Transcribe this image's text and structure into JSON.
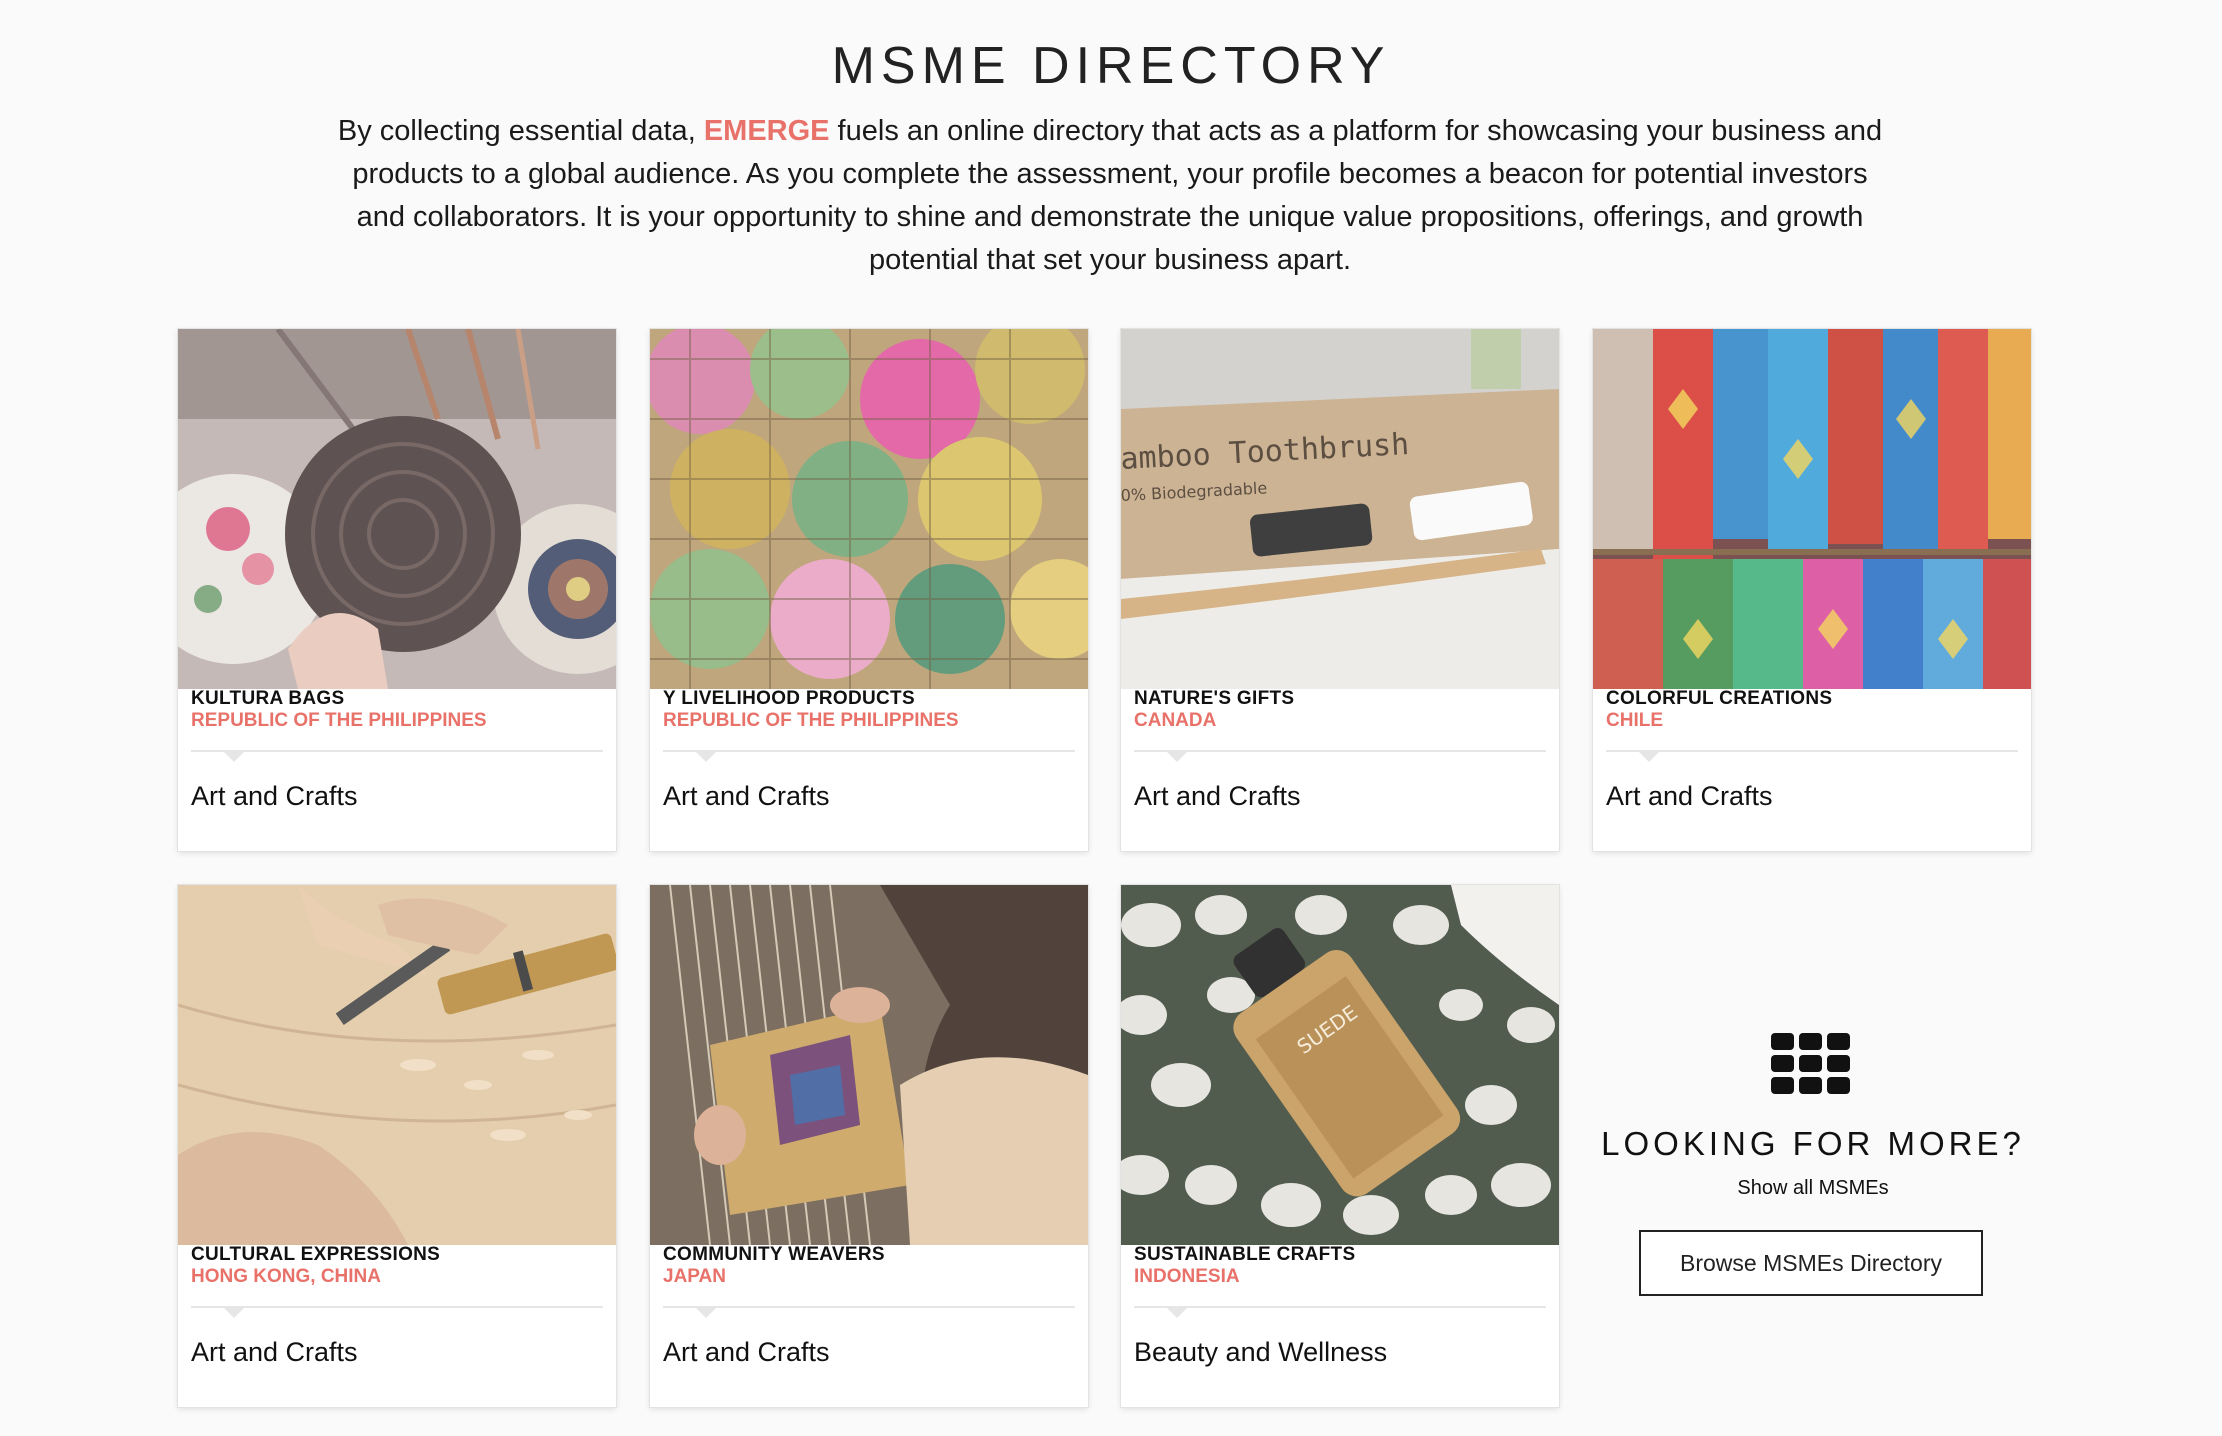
{
  "header": {
    "title": "MSME DIRECTORY",
    "intro_before": "By collecting essential data, ",
    "intro_brand": "EMERGE",
    "intro_after": " fuels an online directory that acts as a platform for showcasing your business and products to a global audience. As you complete the assessment, your profile becomes a beacon for potential investors and collaborators. It is your opportunity to shine and demonstrate the unique value propositions, offerings, and growth potential that set your business apart."
  },
  "colors": {
    "accent": "#e8726a",
    "text": "#111111",
    "background": "#fafafa"
  },
  "cards": [
    {
      "name": "KULTURA BAGS",
      "country": "REPUBLIC OF THE PHILIPPINES",
      "category": "Art and Crafts"
    },
    {
      "name": "Y LIVELIHOOD PRODUCTS",
      "country": "REPUBLIC OF THE PHILIPPINES",
      "category": "Art and Crafts"
    },
    {
      "name": "NATURE'S GIFTS",
      "country": "CANADA",
      "category": "Art and Crafts",
      "image_text": "amboo Toothbrush",
      "image_subtext": "0% Biodegradable"
    },
    {
      "name": "COLORFUL CREATIONS",
      "country": "CHILE",
      "category": "Art and Crafts"
    },
    {
      "name": "CULTURAL EXPRESSIONS",
      "country": "HONG KONG, CHINA",
      "category": "Art and Crafts"
    },
    {
      "name": "COMMUNITY WEAVERS",
      "country": "JAPAN",
      "category": "Art and Crafts"
    },
    {
      "name": "SUSTAINABLE CRAFTS",
      "country": "INDONESIA",
      "category": "Beauty and Wellness",
      "image_text": "SUEDE"
    }
  ],
  "more": {
    "icon": "grid-icon",
    "title": "LOOKING FOR MORE?",
    "subtitle": "Show all MSMEs",
    "button_label": "Browse MSMEs Directory"
  }
}
